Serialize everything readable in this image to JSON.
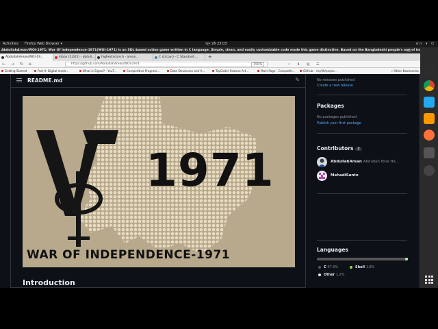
{
  "topbar": {
    "activities": "Activities",
    "app_menu": "Firefox Web Browser ▾",
    "clock": "জুন 26  23:03",
    "tray": "en ▾  ⏻"
  },
  "window": {
    "title": "AbdullahArean/WOI-1971: War Of Independence-1971(WOI-1971) is an SDL-based action game written in C language. Simple, clean, and easily customizable code made this game distinctive. Based on the Bangladeshi people's war of independen..."
  },
  "tabs": [
    {
      "label": "AbdullahArean/WOI-19..."
    },
    {
      "label": "Inbox (2,625) - abdull..."
    },
    {
      "label": "highestscore.h - arean..."
    },
    {
      "label": "C strcpy() - C Standard ..."
    }
  ],
  "nav": {
    "url": "https://github.com/AbdullahArean/WOI-1971",
    "zoom": "150%"
  },
  "bookmarks": [
    {
      "label": "Getting Started"
    },
    {
      "label": "Part II: Digital electr..."
    },
    {
      "label": "What is Signal? - YouT..."
    },
    {
      "label": "Competitive Program..."
    },
    {
      "label": "Data Structures and A..."
    },
    {
      "label": "TopCoder Feature Art..."
    },
    {
      "label": "Main Page - Competiti..."
    },
    {
      "label": "GitHub - rlsy90/projec..."
    }
  ],
  "bookmarks_other": "»  Other Bookmarks",
  "readme": {
    "filename": "README.md",
    "banner_year": "1971",
    "banner_caption": "WAR OF INDEPENDENCE-1971",
    "heading": "Introduction"
  },
  "sidebar": {
    "releases_none": "No releases published",
    "releases_link": "Create a new release",
    "packages_title": "Packages",
    "packages_none": "No packages published",
    "packages_link": "Publish your first package",
    "contributors_title": "Contributors",
    "contributors_count": "2",
    "contributors": [
      {
        "login": "AbdullahArean",
        "name": "Abdullah Ibne Ha..."
      },
      {
        "login": "MehadiSanto",
        "name": ""
      }
    ],
    "languages_title": "Languages",
    "languages": [
      {
        "name": "C",
        "percent": "97.0%",
        "value": 97.0,
        "color": "#555555"
      },
      {
        "name": "Shell",
        "percent": "1.8%",
        "value": 1.8,
        "color": "#89e051"
      },
      {
        "name": "Other",
        "percent": "1.2%",
        "value": 1.2,
        "color": "#ededed"
      }
    ]
  },
  "dock": [
    {
      "icon": "terminal-icon",
      "color": "#2c2c2c"
    },
    {
      "icon": "chrome-icon",
      "color": "#ffffff"
    },
    {
      "icon": "vscode-icon",
      "color": "#23a9f2"
    },
    {
      "icon": "sublime-icon",
      "color": "#ff9800"
    },
    {
      "icon": "firefox-icon",
      "color": "#ff7139"
    },
    {
      "icon": "upload-icon",
      "color": "#555555"
    },
    {
      "icon": "ubuntu-icon",
      "color": "#444444"
    }
  ]
}
